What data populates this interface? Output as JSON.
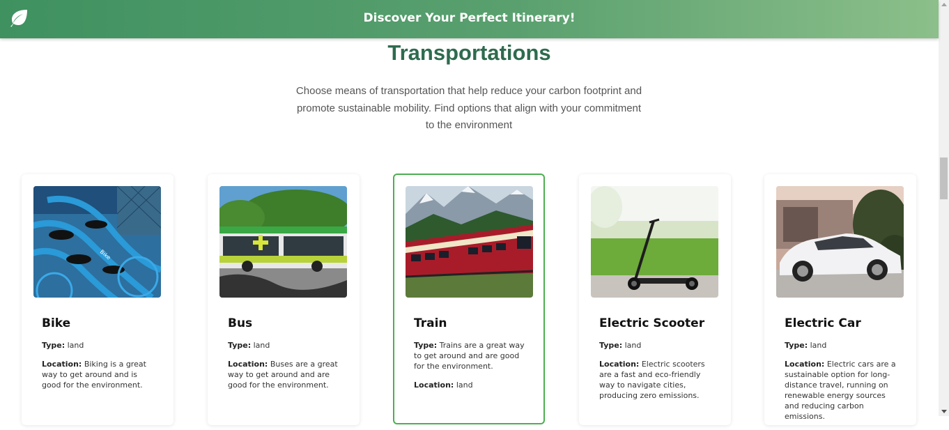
{
  "header": {
    "title": "Discover Your Perfect Itinerary!",
    "logo_icon": "leaf-icon",
    "colors": {
      "start": "#3f9160",
      "end": "#8cbf8a"
    }
  },
  "page": {
    "title": "Transportations",
    "intro": "Choose means of transportation that help reduce your carbon footprint and promote sustainable mobility. Find options that align with your commitment to the environment"
  },
  "labels": {
    "type": "Type:",
    "location": "Location:"
  },
  "cards": [
    {
      "title": "Bike",
      "type": "land",
      "location": "Biking is a great way to get around and is good for the environment.",
      "image": "blue-bikes-photo"
    },
    {
      "title": "Bus",
      "type": "land",
      "location": "Buses are a great way to get around and are good for the environment.",
      "image": "green-bus-photo"
    },
    {
      "title": "Train",
      "type": "Trains are a great way to get around and are good for the environment.",
      "location": "land",
      "image": "red-train-photo",
      "selected": true
    },
    {
      "title": "Electric Scooter",
      "type": "land",
      "location": "Electric scooters are a fast and eco-friendly way to navigate cities, producing zero emissions.",
      "image": "scooter-photo"
    },
    {
      "title": "Electric Car",
      "type": "land",
      "location": "Electric cars are a sustainable option for long-distance travel, running on renewable energy sources and reducing carbon emissions.",
      "image": "white-car-photo"
    }
  ]
}
